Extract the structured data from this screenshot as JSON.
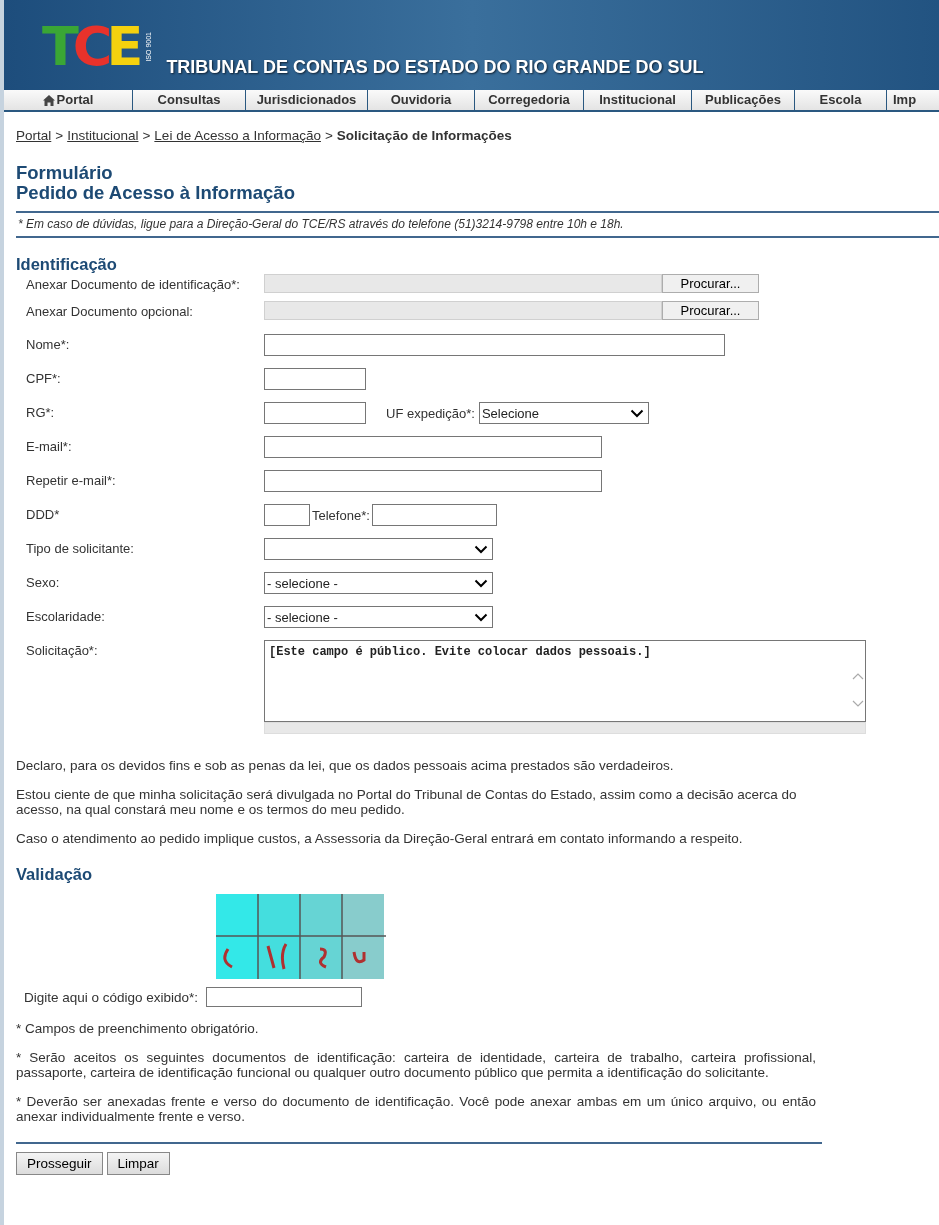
{
  "header": {
    "logo": {
      "letters": [
        "T",
        "C",
        "E"
      ],
      "iso": "ISO 9001"
    },
    "title": "TRIBUNAL DE CONTAS DO ESTADO DO RIO GRANDE DO SUL"
  },
  "nav": [
    {
      "label": "Portal"
    },
    {
      "label": "Consultas"
    },
    {
      "label": "Jurisdicionados"
    },
    {
      "label": "Ouvidoria"
    },
    {
      "label": "Corregedoria"
    },
    {
      "label": "Institucional"
    },
    {
      "label": "Publicações"
    },
    {
      "label": "Escola"
    },
    {
      "label": "Imp"
    }
  ],
  "breadcrumb": [
    {
      "label": "Portal",
      "link": true
    },
    {
      "label": "Institucional",
      "link": true
    },
    {
      "label": "Lei de Acesso a Informação",
      "link": true
    },
    {
      "label": "Solicitação de Informações",
      "link": false
    }
  ],
  "breadcrumb_separator": ">",
  "title_lines": [
    "Formulário",
    "Pedido de Acesso à Informação"
  ],
  "note": "* Em caso de dúvidas, ligue para a Direção-Geral do TCE/RS através do telefone (51)3214-9798 entre 10h e 18h.",
  "identification": {
    "heading": "Identificação",
    "rows": [
      {
        "kind": "file",
        "label": "Anexar Documento de identificação*:",
        "button": "Procurar..."
      },
      {
        "kind": "file",
        "label": "Anexar Documento opcional:",
        "button": "Procurar..."
      },
      {
        "kind": "text",
        "label": "Nome*:"
      },
      {
        "kind": "text",
        "label": "CPF*:"
      },
      {
        "kind": "rg",
        "label": "RG*:",
        "extra_label": "UF expedição*:",
        "select_value": "Selecione"
      },
      {
        "kind": "text",
        "label": "E-mail*:"
      },
      {
        "kind": "text",
        "label": "Repetir e-mail*:"
      },
      {
        "kind": "phone",
        "label": "DDD*",
        "extra_label": "Telefone*:"
      },
      {
        "kind": "select",
        "label": "Tipo de solicitante:"
      },
      {
        "kind": "select",
        "label": "Sexo:",
        "value": "- selecione -"
      },
      {
        "kind": "select",
        "label": "Escolaridade:",
        "value": "- selecione -"
      },
      {
        "kind": "textarea",
        "label": "Solicitação*:",
        "value": "[Este campo é público. Evite colocar dados pessoais.]"
      }
    ]
  },
  "declarations": [
    "Declaro, para os devidos fins e sob as penas da lei, que os dados pessoais acima prestados são verdadeiros.",
    "Estou ciente de que minha solicitação será divulgada no Portal do Tribunal de Contas do Estado, assim como a decisão acerca do acesso, na qual constará meu nome e os termos do meu pedido.",
    "Caso o atendimento ao pedido implique custos, a Assessoria da Direção-Geral entrará em contato informando a respeito."
  ],
  "validation": {
    "heading": "Validação",
    "code_label": "Digite aqui o código exibido*:"
  },
  "footnotes": [
    "* Campos de preenchimento obrigatório.",
    "* Serão aceitos os seguintes documentos de identificação: carteira de identidade, carteira de trabalho, carteira profissional, passaporte, carteira de identificação funcional ou qualquer outro documento público que permita a identificação do solicitante.",
    "* Deverão ser anexadas frente e verso do documento de identificação. Você pode anexar ambas em um único arquivo, ou então anexar individualmente frente e verso."
  ],
  "buttons": [
    "Prosseguir",
    "Limpar"
  ]
}
